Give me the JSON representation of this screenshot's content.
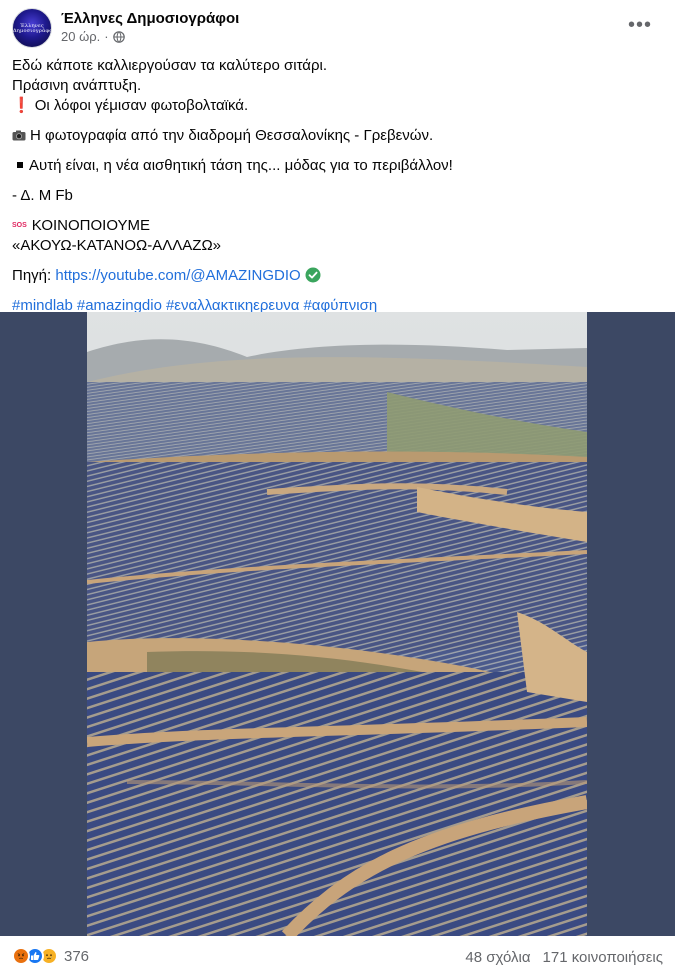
{
  "post": {
    "page_name": "Έλληνες Δημοσιογράφοι",
    "avatar_text_line1": "Έλληνες",
    "avatar_text_line2": "Δημοσιογράφοι",
    "time": "20 ώρ.",
    "separator": "·",
    "privacy_icon": "globe-icon",
    "more_icon": "more-options-icon",
    "lines": {
      "l1": "Εδώ κάποτε καλλιεργούσαν τα καλύτερο σιτάρι.",
      "l2": "Πράσινη ανάπτυξη.",
      "l3_emoji": "❗",
      "l3": "Οι λόφοι γέμισαν φωτοβολταϊκά.",
      "l4": "Η φωτογραφία από την διαδρομή Θεσσαλονίκης - Γρεβενών.",
      "l5": "Αυτή είναι, η νέα αισθητική τάση της... μόδας για το περιβάλλον!",
      "l6": "- Δ. Μ Fb",
      "sos_badge": "SOS",
      "l7": "ΚΟΙΝΟΠΟΙΟΥΜΕ",
      "l8": "«ΑΚΟΥΩ-ΚΑΤΑΝΟΩ-ΑΛΛΑΖΩ»",
      "source_label": "Πηγή:",
      "source_link": "https://youtube.com/@AMAZINGDIO"
    },
    "hashtags": [
      "#mindlab",
      "#amazingdio",
      "#εναλλακτικηερευνα",
      "#αφύπνιση"
    ]
  },
  "footer": {
    "reaction_icons": [
      "angry-icon",
      "like-icon",
      "sad-icon"
    ],
    "reaction_count": "376",
    "comments": "48 σχόλια",
    "shares": "171 κοινοποιήσεις"
  },
  "colors": {
    "link": "#216fdb",
    "media_background": "#3c4864",
    "secondary_text": "#65676b"
  }
}
